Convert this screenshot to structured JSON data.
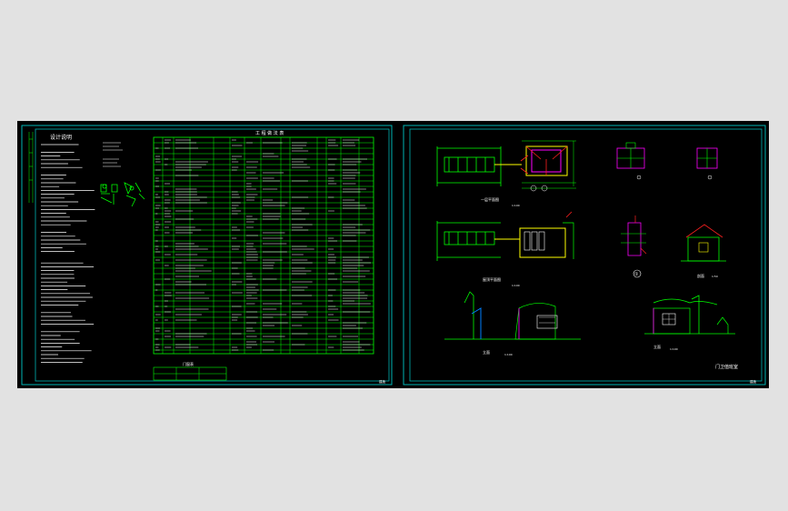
{
  "sheet_left": {
    "design_notes_title": "设计说明",
    "schedule_title": "工 程 做 法 表",
    "small_table_title": "门窗表",
    "sheet_no": "建施"
  },
  "sheet_right": {
    "plan_1_label": "一层平面图",
    "plan_2_label": "屋顶平面图",
    "elev_1_label": "立面",
    "elev_2_label": "立面",
    "section_label": "剖面",
    "detail_label": "①",
    "title_block_name": "门卫值班室",
    "sheet_no": "建施",
    "scale_100": "1:100",
    "scale_50": "1:50"
  },
  "colors": {
    "background": "#e2e2e2",
    "cad_bg": "#000000",
    "frame": "#00b4b4",
    "green": "#00ff00",
    "yellow": "#ffff00",
    "magenta": "#ff00ff",
    "red": "#ff2020",
    "cyan": "#00ffff",
    "white": "#ffffff"
  }
}
